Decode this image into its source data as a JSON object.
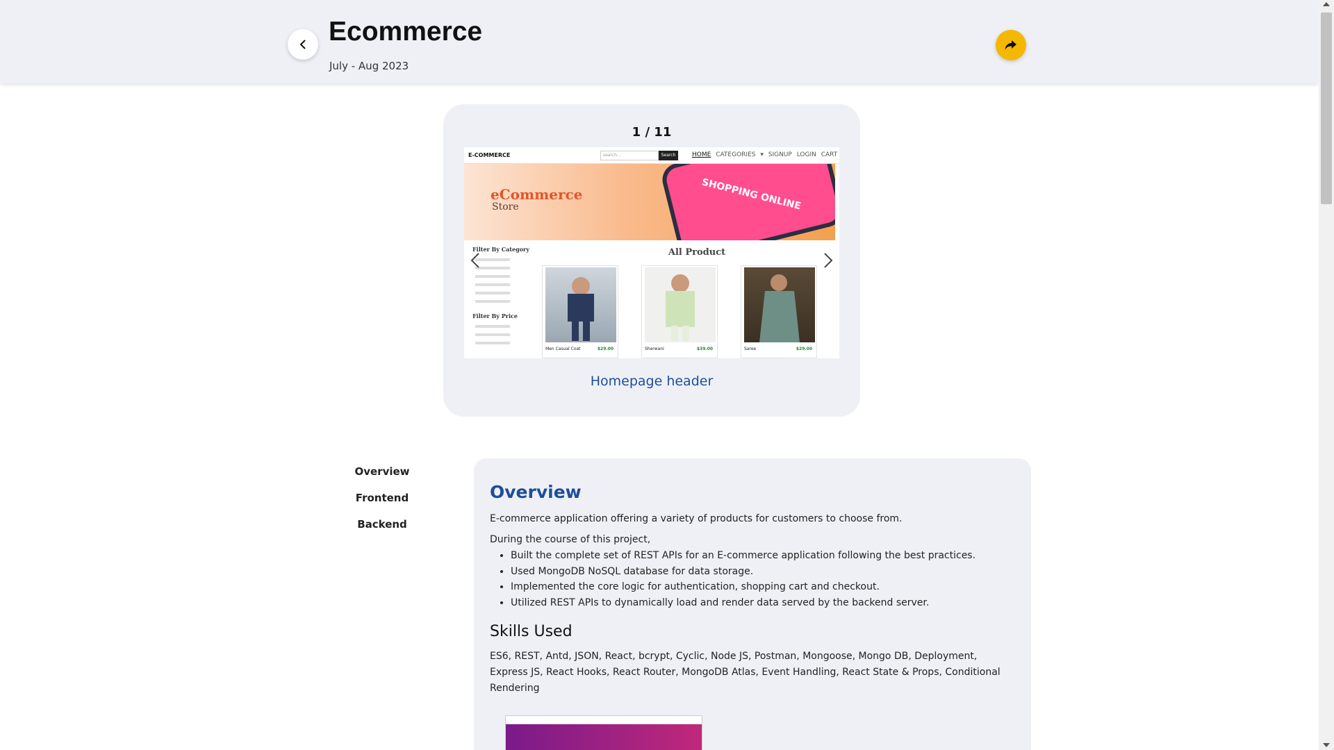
{
  "header": {
    "title": "Ecommerce",
    "date": "July - Aug 2023"
  },
  "carousel": {
    "counter": "1 / 11",
    "caption": "Homepage header",
    "slide": {
      "brand": "E-COMMERCE",
      "search_placeholder": "search...",
      "search_button": "Search",
      "nav_links": [
        "HOME",
        "CATEGORIES ▾",
        "SIGNUP",
        "LOGIN",
        "CART"
      ],
      "banner_title": "eCommerce",
      "banner_subtitle": "Store",
      "banner_phone_text": "SHOPPING ONLINE",
      "filter_category_title": "Filter By Category",
      "filter_price_title": "Filter By Price",
      "all_product_title": "All Product",
      "products": [
        {
          "name": "Men Casual Coat",
          "price": "$29.00",
          "color": "#3a4a6a"
        },
        {
          "name": "Sherwani",
          "price": "$39.00",
          "color": "#cfe3b8"
        },
        {
          "name": "Saree",
          "price": "$29.00",
          "color": "#6e8f86"
        }
      ]
    }
  },
  "side_nav": {
    "items": [
      "Overview",
      "Frontend",
      "Backend"
    ]
  },
  "overview": {
    "heading": "Overview",
    "intro": "E-commerce application offering a variety of products for customers to choose from.",
    "course_intro": "During the course of this project,",
    "bullets": [
      "Built the complete set of REST APIs for an E-commerce application following the best practices.",
      "Used MongoDB NoSQL database for data storage.",
      "Implemented the core logic for authentication, shopping cart and checkout.",
      "Utilized REST APIs to dynamically load and render data served by the backend server."
    ],
    "skills_heading": "Skills Used",
    "skills": "ES6, REST, Antd, JSON, React, bcrypt, Cyclic, Node JS, Postman, Mongoose, Mongo DB, Deployment, Express JS, React Hooks, React Router, MongoDB Atlas, Event Handling, React State & Props, Conditional Rendering"
  },
  "colors": {
    "accent_blue": "#1d4e9a",
    "share_yellow": "#f5b800",
    "panel_bg": "#eef0f6"
  }
}
